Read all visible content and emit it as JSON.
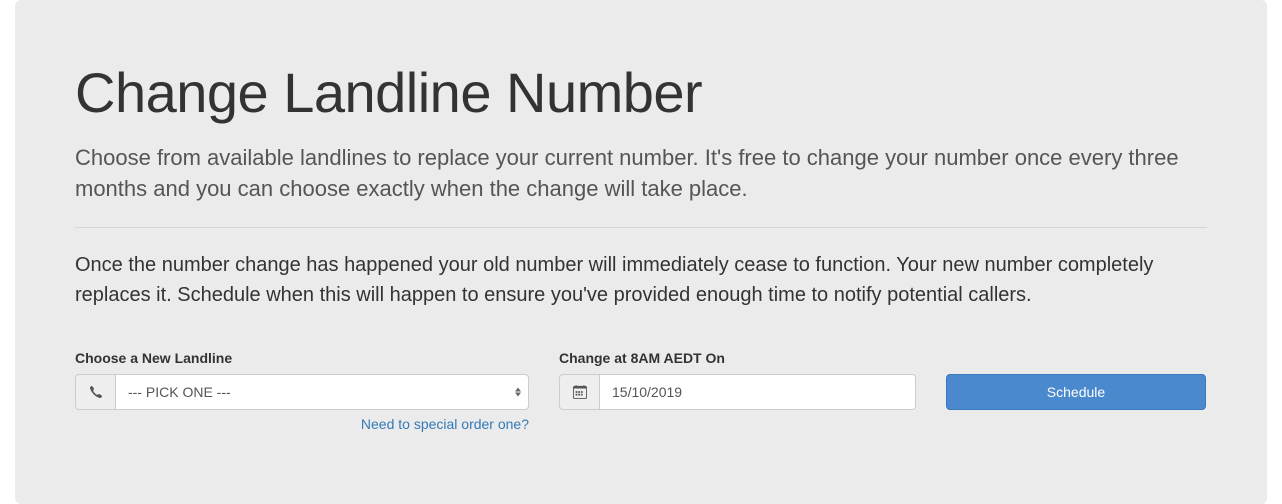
{
  "header": {
    "title": "Change Landline Number",
    "lead": "Choose from available landlines to replace your current number. It's free to change your number once every three months and you can choose exactly when the change will take place.",
    "body": "Once the number change has happened your old number will immediately cease to function. Your new number completely replaces it. Schedule when this will happen to ensure you've provided enough time to notify potential callers."
  },
  "form": {
    "landline": {
      "label": "Choose a New Landline",
      "selected": "--- PICK ONE ---",
      "help_link": "Need to special order one?"
    },
    "date": {
      "label": "Change at 8AM AEDT On",
      "value": "15/10/2019"
    },
    "submit": {
      "label": "Schedule"
    }
  }
}
